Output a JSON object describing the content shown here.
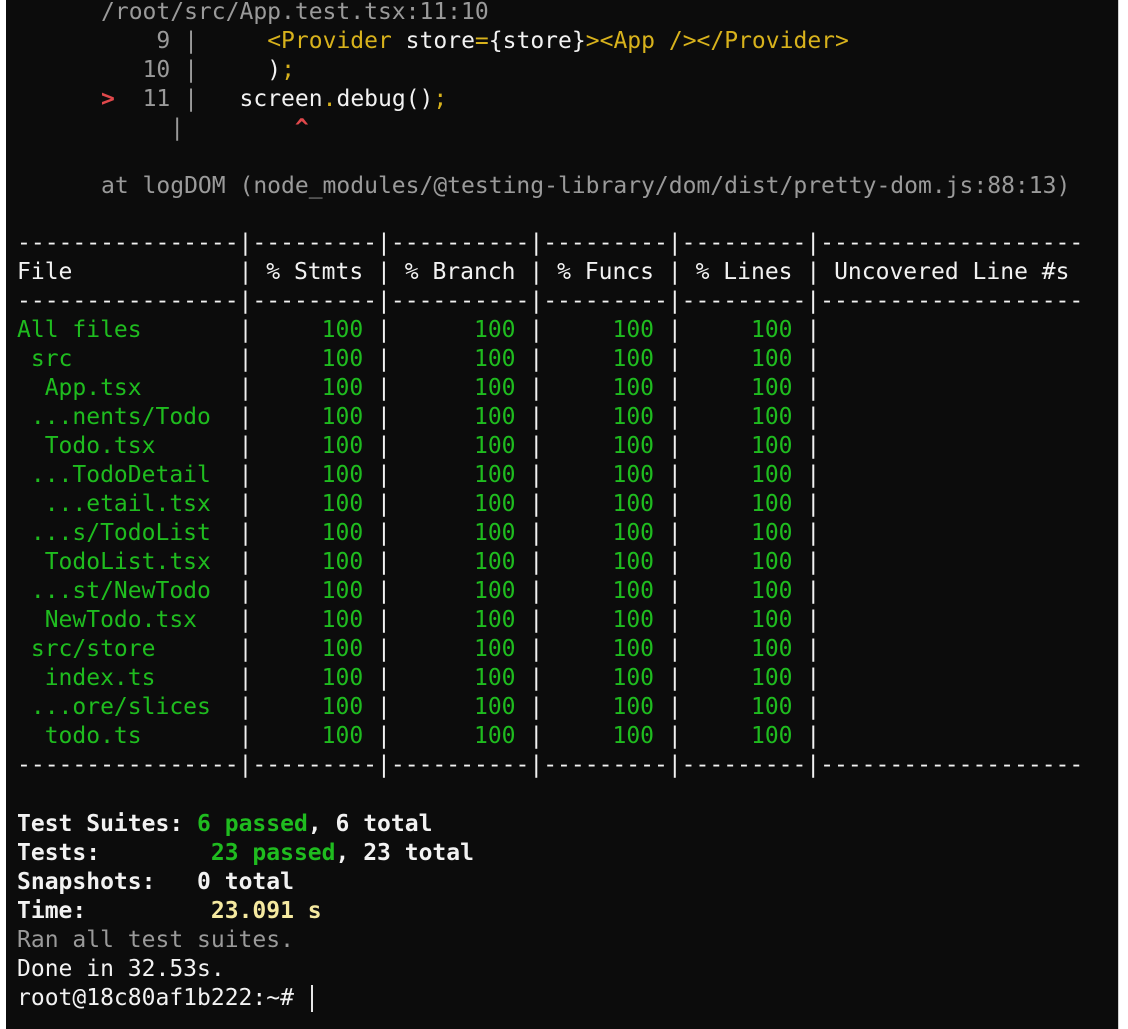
{
  "terminal": {
    "error_location": "/root/src/App.test.tsx:11:10",
    "code_frame": [
      {
        "marker": " ",
        "num": "9",
        "pre": "    ",
        "tag_open": "<Provider",
        "attr": " store",
        "eq": "=",
        "brace_open": "{",
        "value": "store",
        "brace_close": "}",
        "gt": ">",
        "app": "<App />",
        "close": "</Provider>"
      },
      {
        "marker": " ",
        "num": "10",
        "text": "    )",
        "semi": ";"
      },
      {
        "marker": ">",
        "num": "11",
        "obj": "screen",
        "dot": ".",
        "call": "debug()",
        "semi": ";"
      },
      {
        "caret": "^"
      }
    ],
    "stack_line": "at logDOM (node_modules/@testing-library/dom/dist/pretty-dom.js:88:13)",
    "coverage": {
      "separator": "----------------|---------|----------|---------|---------|-------------------",
      "headers": [
        "File",
        "% Stmts",
        "% Branch",
        "% Funcs",
        "% Lines",
        "Uncovered Line #s"
      ],
      "rows": [
        {
          "file": "All files",
          "stmts": "100",
          "branch": "100",
          "funcs": "100",
          "lines": "100",
          "uncovered": ""
        },
        {
          "file": " src",
          "stmts": "100",
          "branch": "100",
          "funcs": "100",
          "lines": "100",
          "uncovered": ""
        },
        {
          "file": "  App.tsx",
          "stmts": "100",
          "branch": "100",
          "funcs": "100",
          "lines": "100",
          "uncovered": ""
        },
        {
          "file": " ...nents/Todo",
          "stmts": "100",
          "branch": "100",
          "funcs": "100",
          "lines": "100",
          "uncovered": ""
        },
        {
          "file": "  Todo.tsx",
          "stmts": "100",
          "branch": "100",
          "funcs": "100",
          "lines": "100",
          "uncovered": ""
        },
        {
          "file": " ...TodoDetail",
          "stmts": "100",
          "branch": "100",
          "funcs": "100",
          "lines": "100",
          "uncovered": ""
        },
        {
          "file": "  ...etail.tsx",
          "stmts": "100",
          "branch": "100",
          "funcs": "100",
          "lines": "100",
          "uncovered": ""
        },
        {
          "file": " ...s/TodoList",
          "stmts": "100",
          "branch": "100",
          "funcs": "100",
          "lines": "100",
          "uncovered": ""
        },
        {
          "file": "  TodoList.tsx",
          "stmts": "100",
          "branch": "100",
          "funcs": "100",
          "lines": "100",
          "uncovered": ""
        },
        {
          "file": " ...st/NewTodo",
          "stmts": "100",
          "branch": "100",
          "funcs": "100",
          "lines": "100",
          "uncovered": ""
        },
        {
          "file": "  NewTodo.tsx",
          "stmts": "100",
          "branch": "100",
          "funcs": "100",
          "lines": "100",
          "uncovered": ""
        },
        {
          "file": " src/store",
          "stmts": "100",
          "branch": "100",
          "funcs": "100",
          "lines": "100",
          "uncovered": ""
        },
        {
          "file": "  index.ts",
          "stmts": "100",
          "branch": "100",
          "funcs": "100",
          "lines": "100",
          "uncovered": ""
        },
        {
          "file": " ...ore/slices",
          "stmts": "100",
          "branch": "100",
          "funcs": "100",
          "lines": "100",
          "uncovered": ""
        },
        {
          "file": "  todo.ts",
          "stmts": "100",
          "branch": "100",
          "funcs": "100",
          "lines": "100",
          "uncovered": ""
        }
      ]
    },
    "summary": {
      "suites_label": "Test Suites:",
      "suites_passed": "6 passed",
      "suites_total": ", 6 total",
      "tests_label": "Tests:",
      "tests_passed": "23 passed",
      "tests_total": ", 23 total",
      "snapshots_label": "Snapshots:",
      "snapshots_value": "0 total",
      "time_label": "Time:",
      "time_value": "23.091 s",
      "ran_all": "Ran all test suites.",
      "done": "Done in 32.53s."
    },
    "prompt": "root@18c80af1b222:~#"
  },
  "colors": {
    "background": "#0c0c0c",
    "text": "#e6e6e6",
    "pass_green": "#1fbc1f",
    "code_yellow": "#d8b21c",
    "error_red": "#e0484b",
    "dim_gray": "#9a9a9a"
  }
}
